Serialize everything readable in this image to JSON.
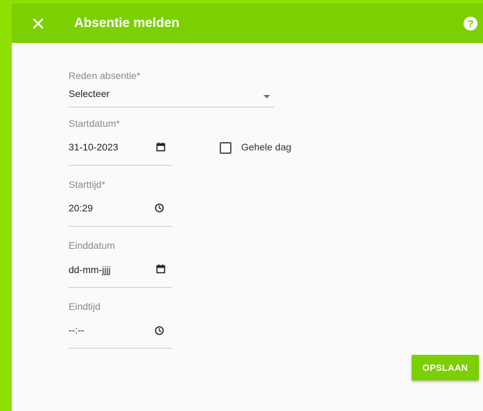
{
  "header": {
    "title": "Absentie melden",
    "close_icon": "close-icon",
    "help_icon": "help-circle-icon",
    "color": "#7ccf00"
  },
  "form": {
    "reason": {
      "label": "Reden absentie*",
      "value": "Selecteer",
      "icon": "dropdown-arrow-icon"
    },
    "start_date": {
      "label": "Startdatum*",
      "value": "31-10-2023",
      "icon": "calendar-icon"
    },
    "full_day": {
      "label": "Gehele dag",
      "checked": false
    },
    "start_time": {
      "label": "Starttijd*",
      "value": "20:29",
      "icon": "clock-icon"
    },
    "end_date": {
      "label": "Einddatum",
      "value": "dd-mm-jjjj",
      "icon": "calendar-icon"
    },
    "end_time": {
      "label": "Eindtijd",
      "value": "--:--",
      "icon": "clock-icon"
    }
  },
  "actions": {
    "save_label": "OPSLAAN"
  },
  "colors": {
    "accent": "#7ccf00",
    "background_strip": "#8ee000",
    "panel": "#fafafa"
  }
}
